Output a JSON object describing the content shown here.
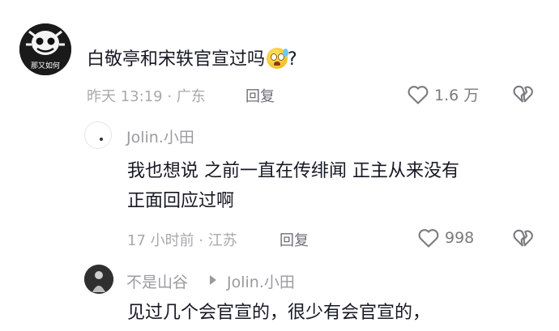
{
  "comments": [
    {
      "avatar_caption": "那又如何",
      "text": "白敬亭和宋轶官宣过吗",
      "meta": "昨天 13:19 · 广东",
      "reply_label": "回复",
      "likes": "1.6 万"
    }
  ],
  "replies": [
    {
      "username": "Jolin.小田",
      "text_line1": "我也想说 之前一直在传绯闻 正主从来没有",
      "text_line2": "正面回应过啊",
      "meta": "17 小时前 · 江苏",
      "reply_label": "回复",
      "likes": "998"
    },
    {
      "username": "不是山谷",
      "reply_to": "Jolin.小田",
      "text_line1": "见过几个会官宣的，很少有会官宣的，"
    }
  ],
  "top_comment_suffix": "?"
}
